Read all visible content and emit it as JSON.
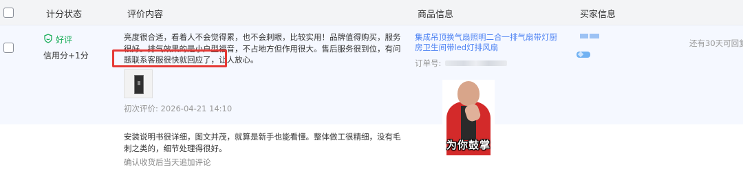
{
  "header": {
    "score_status": "计分状态",
    "review_content": "评价内容",
    "product_info": "商品信息",
    "buyer_info": "买家信息"
  },
  "review": {
    "rating": "好评",
    "credit": "信用分+1分",
    "text": "亮度很合适，看着人不会觉得累，也不会刺眼，比较实用！品牌值得购买，服务很好。排气效果的是小户型福音，不占地方但作用很大。售后服务很到位，有问题联系客服很快就回应了，让人放心。",
    "highlight_text": "客服很快就回应了，让人放心。",
    "first_review": "初次评价: 2026-04-21 14:10"
  },
  "product": {
    "name": "集成吊顶换气扇照明二合一排气扇带灯厨房卫生间带led灯排风扇",
    "order_label": "订单号:"
  },
  "days_left": "还有30天可回复",
  "append": {
    "text": "安装说明书很详细，图文并茂，就算是新手也能看懂。整体做工很精细，没有毛刺之类的，细节处理得很好。",
    "note": "确认收货后当天追加评论"
  },
  "meme": {
    "caption": "为你鼓掌"
  },
  "colors": {
    "positive_green": "#1aad5a",
    "link_blue": "#4d82f3",
    "highlight_red": "#e53935",
    "header_bg": "#f3f4f6",
    "row_bg": "#f5f8ff"
  },
  "icons": {
    "rating": "smile-shield-icon",
    "vip": "diamond-badge-icon"
  }
}
